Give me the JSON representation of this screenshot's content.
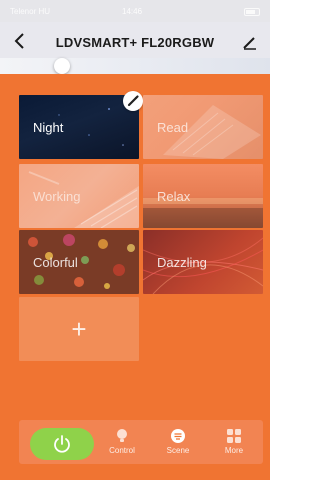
{
  "status_bar": {
    "carrier": "Telenor HU",
    "time": "14:46"
  },
  "header": {
    "title": "LDVSMART+ FL20RGBW"
  },
  "brightness": {
    "level_fraction": 0.24
  },
  "scenes": [
    {
      "label": "Night",
      "selected": true
    },
    {
      "label": "Read"
    },
    {
      "label": "Working"
    },
    {
      "label": "Relax"
    },
    {
      "label": "Colorful"
    },
    {
      "label": "Dazzling"
    }
  ],
  "add_scene_symbol": "+",
  "tabs": [
    {
      "label": "Control",
      "icon": "bulb-icon"
    },
    {
      "label": "Scene",
      "icon": "scene-icon",
      "active": true
    },
    {
      "label": "More",
      "icon": "grid-icon"
    }
  ],
  "colors": {
    "accent": "#f07432",
    "power_on": "#8fd24a",
    "night_tile": "#0a1a36"
  }
}
